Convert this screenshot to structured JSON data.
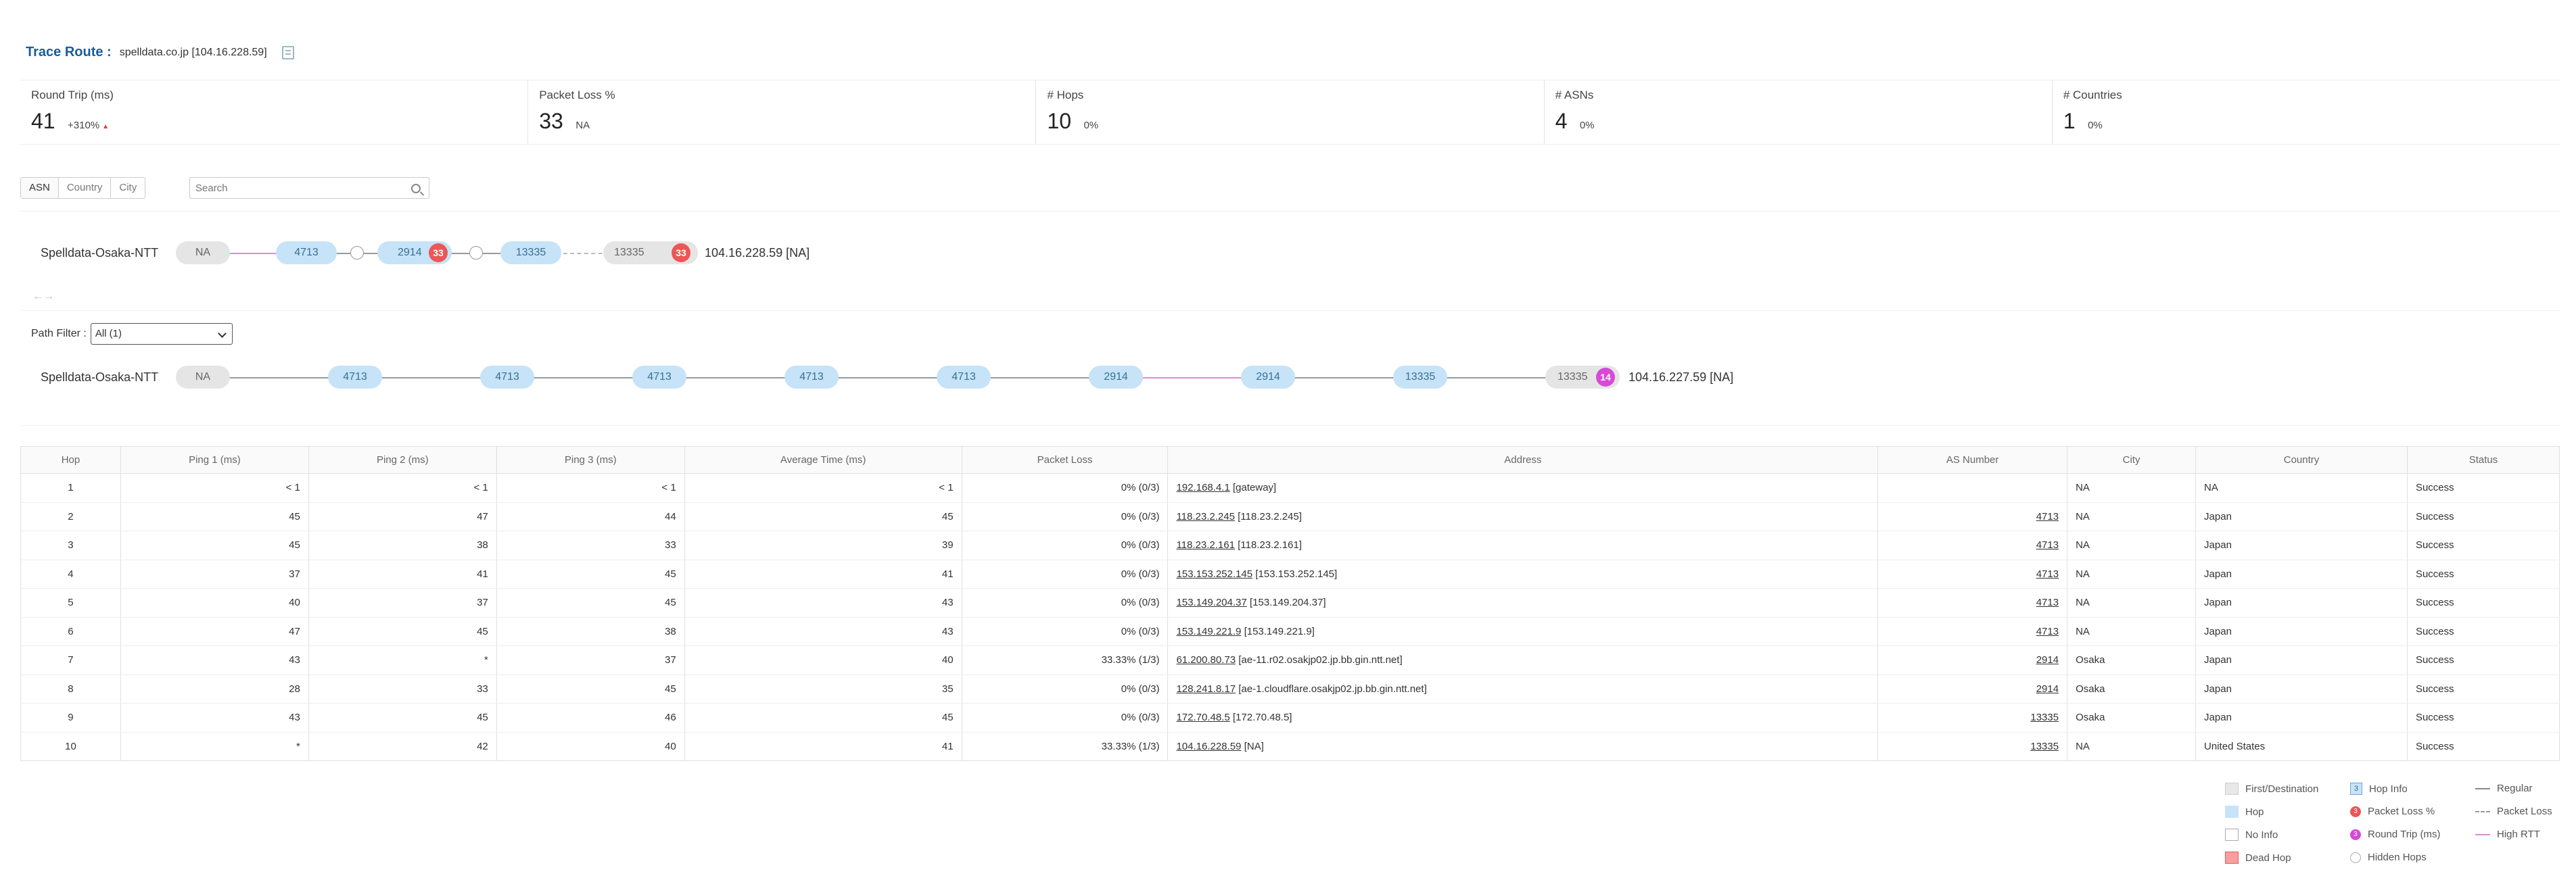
{
  "header": {
    "label": "Trace Route :",
    "host": "spelldata.co.jp [104.16.228.59]"
  },
  "metrics": [
    {
      "title": "Round Trip (ms)",
      "value": "41",
      "delta": "+310%"
    },
    {
      "title": "Packet Loss %",
      "value": "33",
      "delta": "NA"
    },
    {
      "title": "# Hops",
      "value": "10",
      "delta": "0%"
    },
    {
      "title": "# ASNs",
      "value": "4",
      "delta": "0%"
    },
    {
      "title": "# Countries",
      "value": "1",
      "delta": "0%"
    }
  ],
  "colors": {
    "accent": "#1a5d99",
    "hop": "#c6e3f8",
    "first_dest": "#e5e5e5",
    "packet_loss": "#ee5555",
    "round_trip": "#d64ad6",
    "high_rtt": "#e08ad8"
  },
  "toggle": [
    "ASN",
    "Country",
    "City"
  ],
  "search": {
    "placeholder": "Search",
    "value": ""
  },
  "path_asn": {
    "source": "Spelldata-Osaka-NTT",
    "nodes": [
      "NA",
      "4713",
      "2914",
      "13335",
      "13335"
    ],
    "badges": [
      "33",
      "33"
    ],
    "destination": "104.16.228.59 [NA]"
  },
  "arrows": "←→",
  "path_filter": {
    "label": "Path Filter :",
    "selected": "All (1)"
  },
  "path_full": {
    "source": "Spelldata-Osaka-NTT",
    "nodes": [
      "NA",
      "4713",
      "4713",
      "4713",
      "4713",
      "4713",
      "2914",
      "2914",
      "13335",
      "13335"
    ],
    "badge": "14",
    "destination": "104.16.227.59 [NA]"
  },
  "table": {
    "columns": [
      "Hop",
      "Ping 1 (ms)",
      "Ping 2 (ms)",
      "Ping 3 (ms)",
      "Average Time (ms)",
      "Packet Loss",
      "Address",
      "AS Number",
      "City",
      "Country",
      "Status"
    ],
    "rows": [
      {
        "hop": "1",
        "p1": "< 1",
        "p2": "< 1",
        "p3": "< 1",
        "avg": "< 1",
        "loss": "0% (0/3)",
        "ip": "192.168.4.1",
        "host": "[gateway]",
        "asn": "",
        "city": "NA",
        "country": "NA",
        "status": "Success"
      },
      {
        "hop": "2",
        "p1": "45",
        "p2": "47",
        "p3": "44",
        "avg": "45",
        "loss": "0% (0/3)",
        "ip": "118.23.2.245",
        "host": "[118.23.2.245]",
        "asn": "4713",
        "city": "NA",
        "country": "Japan",
        "status": "Success"
      },
      {
        "hop": "3",
        "p1": "45",
        "p2": "38",
        "p3": "33",
        "avg": "39",
        "loss": "0% (0/3)",
        "ip": "118.23.2.161",
        "host": "[118.23.2.161]",
        "asn": "4713",
        "city": "NA",
        "country": "Japan",
        "status": "Success"
      },
      {
        "hop": "4",
        "p1": "37",
        "p2": "41",
        "p3": "45",
        "avg": "41",
        "loss": "0% (0/3)",
        "ip": "153.153.252.145",
        "host": "[153.153.252.145]",
        "asn": "4713",
        "city": "NA",
        "country": "Japan",
        "status": "Success"
      },
      {
        "hop": "5",
        "p1": "40",
        "p2": "37",
        "p3": "45",
        "avg": "43",
        "loss": "0% (0/3)",
        "ip": "153.149.204.37",
        "host": "[153.149.204.37]",
        "asn": "4713",
        "city": "NA",
        "country": "Japan",
        "status": "Success"
      },
      {
        "hop": "6",
        "p1": "47",
        "p2": "45",
        "p3": "38",
        "avg": "43",
        "loss": "0% (0/3)",
        "ip": "153.149.221.9",
        "host": "[153.149.221.9]",
        "asn": "4713",
        "city": "NA",
        "country": "Japan",
        "status": "Success"
      },
      {
        "hop": "7",
        "p1": "43",
        "p2": "*",
        "p3": "37",
        "avg": "40",
        "loss": "33.33% (1/3)",
        "ip": "61.200.80.73",
        "host": "[ae-11.r02.osakjp02.jp.bb.gin.ntt.net]",
        "asn": "2914",
        "city": "Osaka",
        "country": "Japan",
        "status": "Success"
      },
      {
        "hop": "8",
        "p1": "28",
        "p2": "33",
        "p3": "45",
        "avg": "35",
        "loss": "0% (0/3)",
        "ip": "128.241.8.17",
        "host": "[ae-1.cloudflare.osakjp02.jp.bb.gin.ntt.net]",
        "asn": "2914",
        "city": "Osaka",
        "country": "Japan",
        "status": "Success"
      },
      {
        "hop": "9",
        "p1": "43",
        "p2": "45",
        "p3": "46",
        "avg": "45",
        "loss": "0% (0/3)",
        "ip": "172.70.48.5",
        "host": "[172.70.48.5]",
        "asn": "13335",
        "city": "Osaka",
        "country": "Japan",
        "status": "Success"
      },
      {
        "hop": "10",
        "p1": "*",
        "p2": "42",
        "p3": "40",
        "avg": "41",
        "loss": "33.33% (1/3)",
        "ip": "104.16.228.59",
        "host": "[NA]",
        "asn": "13335",
        "city": "NA",
        "country": "United States",
        "status": "Success"
      }
    ]
  },
  "legend": {
    "first_dest": "First/Destination",
    "hop": "Hop",
    "no_info": "No Info",
    "dead_hop": "Dead Hop",
    "hop_info": "Hop Info",
    "packet_loss": "Packet Loss %",
    "round_trip": "Round Trip (ms)",
    "hidden_hops": "Hidden Hops",
    "regular": "Regular",
    "packet_loss_line": "Packet Loss",
    "high_rtt": "High RTT",
    "sample": "3"
  }
}
